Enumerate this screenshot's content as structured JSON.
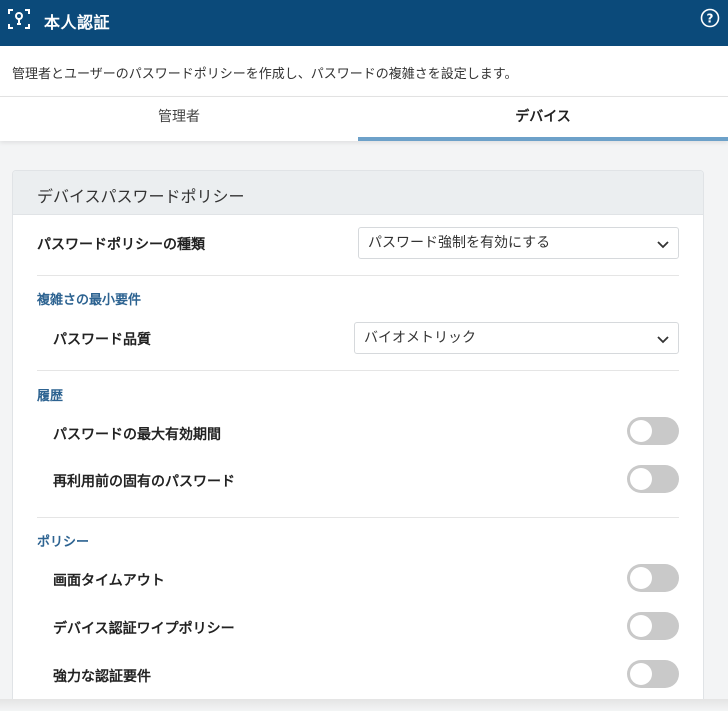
{
  "header": {
    "title": "本人認証",
    "logo_icon": "face-id-icon",
    "help_icon": "help-icon",
    "bg_color": "#0b4a7a"
  },
  "description": "管理者とユーザーのパスワードポリシーを作成し、パスワードの複雑さを設定します。",
  "tabs": [
    {
      "label": "管理者",
      "active": false
    },
    {
      "label": "デバイス",
      "active": true
    }
  ],
  "card": {
    "title": "デバイスパスワードポリシー",
    "policy_type": {
      "label": "パスワードポリシーの種類",
      "value": "パスワード強制を有効にする"
    },
    "complexity": {
      "title": "複雑さの最小要件",
      "quality": {
        "label": "パスワード品質",
        "value": "バイオメトリック"
      }
    },
    "history": {
      "title": "履歴",
      "items": [
        {
          "label": "パスワードの最大有効期間",
          "on": false
        },
        {
          "label": "再利用前の固有のパスワード",
          "on": false
        }
      ]
    },
    "policy": {
      "title": "ポリシー",
      "items": [
        {
          "label": "画面タイムアウト",
          "on": false
        },
        {
          "label": "デバイス認証ワイプポリシー",
          "on": false
        },
        {
          "label": "強力な認証要件",
          "on": false
        }
      ]
    }
  },
  "colors": {
    "accent": "#2d6391",
    "tab_underline": "#6da1c9",
    "toggle_off": "#c9c9c9"
  }
}
